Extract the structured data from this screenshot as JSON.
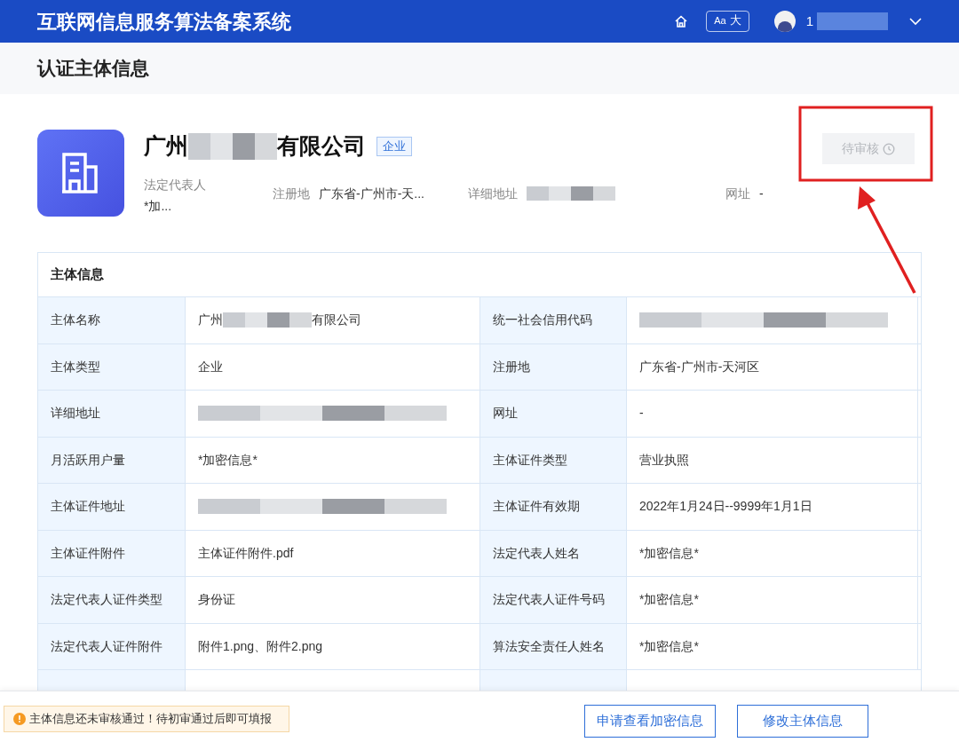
{
  "header": {
    "title": "互联网信息服务算法备案系统",
    "font_button": {
      "small": "Aa",
      "large": "大"
    },
    "user": {
      "name": "1"
    }
  },
  "page_title": "认证主体信息",
  "company": {
    "name": [
      {
        "kind": "text",
        "text": "广州"
      },
      {
        "kind": "redacted"
      },
      {
        "kind": "text",
        "text": "有限公司"
      }
    ],
    "tag": "企业",
    "status": "待审核",
    "meta": [
      {
        "label": "法定代表人",
        "value": [
          {
            "kind": "text",
            "text": "*加..."
          }
        ],
        "stacked": true
      },
      {
        "label": "注册地",
        "value": [
          {
            "kind": "text",
            "text": "广东省-广州市-天..."
          }
        ],
        "stacked": false
      },
      {
        "label": "详细地址",
        "value": [
          {
            "kind": "redacted"
          }
        ],
        "stacked": false
      },
      {
        "label": "网址",
        "value": [
          {
            "kind": "text",
            "text": "-"
          }
        ],
        "stacked": false
      }
    ]
  },
  "table": {
    "title": "主体信息",
    "rows": [
      [
        {
          "label": "主体名称",
          "value": [
            {
              "kind": "text",
              "text": "广州"
            },
            {
              "kind": "redacted"
            },
            {
              "kind": "text",
              "text": "有限公司"
            }
          ]
        },
        {
          "label": "统一社会信用代码",
          "value": [
            {
              "kind": "redacted"
            }
          ]
        }
      ],
      [
        {
          "label": "主体类型",
          "value": [
            {
              "kind": "text",
              "text": "企业"
            }
          ]
        },
        {
          "label": "注册地",
          "value": [
            {
              "kind": "text",
              "text": "广东省-广州市-天河区"
            }
          ]
        }
      ],
      [
        {
          "label": "详细地址",
          "value": [
            {
              "kind": "redacted"
            }
          ]
        },
        {
          "label": "网址",
          "value": [
            {
              "kind": "text",
              "text": "-"
            }
          ]
        }
      ],
      [
        {
          "label": "月活跃用户量",
          "value": [
            {
              "kind": "text",
              "text": "*加密信息*"
            }
          ]
        },
        {
          "label": "主体证件类型",
          "value": [
            {
              "kind": "text",
              "text": "营业执照"
            }
          ]
        }
      ],
      [
        {
          "label": "主体证件地址",
          "value": [
            {
              "kind": "redacted"
            }
          ]
        },
        {
          "label": "主体证件有效期",
          "value": [
            {
              "kind": "text",
              "text": "2022年1月24日--9999年1月1日"
            }
          ]
        }
      ],
      [
        {
          "label": "主体证件附件",
          "value": [
            {
              "kind": "text",
              "text": "主体证件附件.pdf"
            }
          ]
        },
        {
          "label": "法定代表人姓名",
          "value": [
            {
              "kind": "text",
              "text": "*加密信息*"
            }
          ]
        }
      ],
      [
        {
          "label": "法定代表人证件类型",
          "value": [
            {
              "kind": "text",
              "text": "身份证"
            }
          ]
        },
        {
          "label": "法定代表人证件号码",
          "value": [
            {
              "kind": "text",
              "text": "*加密信息*"
            }
          ]
        }
      ],
      [
        {
          "label": "法定代表人证件附件",
          "value": [
            {
              "kind": "text",
              "text": "附件1.png、附件2.png"
            }
          ]
        },
        {
          "label": "算法安全责任人姓名",
          "value": [
            {
              "kind": "text",
              "text": "*加密信息*"
            }
          ]
        }
      ]
    ]
  },
  "footer": {
    "notice": "主体信息还未审核通过！待初审通过后即可填报",
    "buttons": [
      "申请查看加密信息",
      "修改主体信息"
    ]
  }
}
